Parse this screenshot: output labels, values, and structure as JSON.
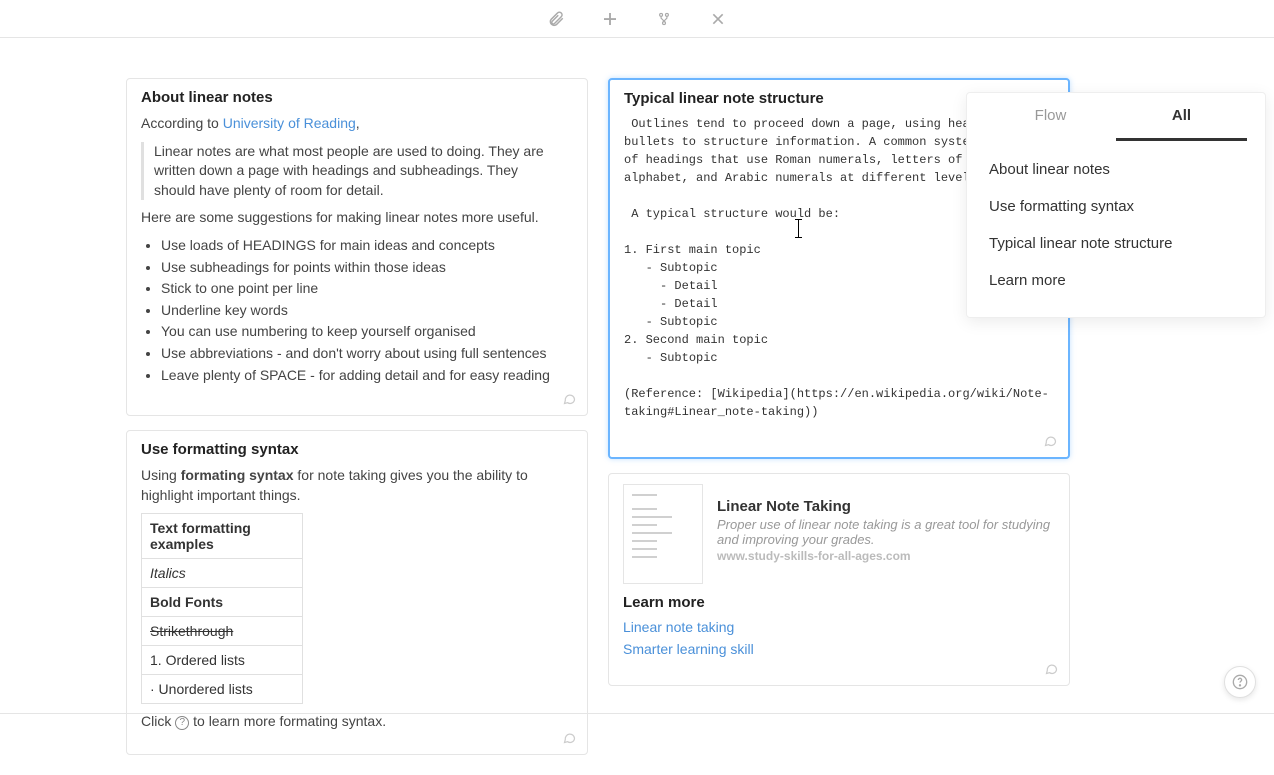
{
  "toolbar": {
    "icons": [
      "attachment-icon",
      "add-icon",
      "merge-icon",
      "close-icon"
    ]
  },
  "cards": {
    "about": {
      "title": "About linear notes",
      "prefix": "According to ",
      "source_link": "University of Reading",
      "source_suffix": ",",
      "quote": "Linear notes are what most people are used to doing. They are written down a page with headings and subheadings. They should have plenty of room for detail.",
      "suggestions_intro": "Here are some suggestions for making linear notes more useful.",
      "tips": [
        "Use loads of HEADINGS for main ideas and concepts",
        "Use subheadings for points within those ideas",
        "Stick to one point per line",
        "Underline key words",
        "You can use numbering to keep yourself organised",
        "Use abbreviations - and don't worry about using full sentences",
        "Leave plenty of SPACE - for adding detail and for easy reading"
      ]
    },
    "formatting": {
      "title": "Use formatting syntax",
      "p1a": "Using ",
      "p1b": "formating syntax",
      "p1c": " for note taking gives you the ability to highlight important things.",
      "table_header": "Text formatting examples",
      "rows": {
        "italics": "Italics",
        "bold": "Bold Fonts",
        "strike": "Strikethrough",
        "ordered": "1. Ordered lists",
        "unordered": "· Unordered lists"
      },
      "click_a": "Click ",
      "click_b": " to learn more formating syntax."
    },
    "structure": {
      "title": "Typical linear note structure",
      "body": " Outlines tend to proceed down a page, using headings and bullets to structure information. A common system consists of headings that use Roman numerals, letters of the alphabet, and Arabic numerals at different levels.\n\n A typical structure would be:\n\n1. First main topic\n   - Subtopic\n     - Detail\n     - Detail\n   - Subtopic\n2. Second main topic\n   - Subtopic\n\n(Reference: [Wikipedia](https://en.wikipedia.org/wiki/Note-taking#Linear_note-taking))"
    },
    "learn": {
      "link_title": "Linear Note Taking",
      "link_desc": "Proper use of linear note taking is a great tool for studying and improving your grades.",
      "link_url": "www.study-skills-for-all-ages.com",
      "title": "Learn more",
      "links": [
        "Linear note taking",
        "Smarter learning skill"
      ]
    }
  },
  "outline": {
    "tabs": {
      "flow": "Flow",
      "all": "All"
    },
    "items": [
      "About linear notes",
      "Use formatting syntax",
      "Typical linear note structure",
      "Learn more"
    ]
  }
}
